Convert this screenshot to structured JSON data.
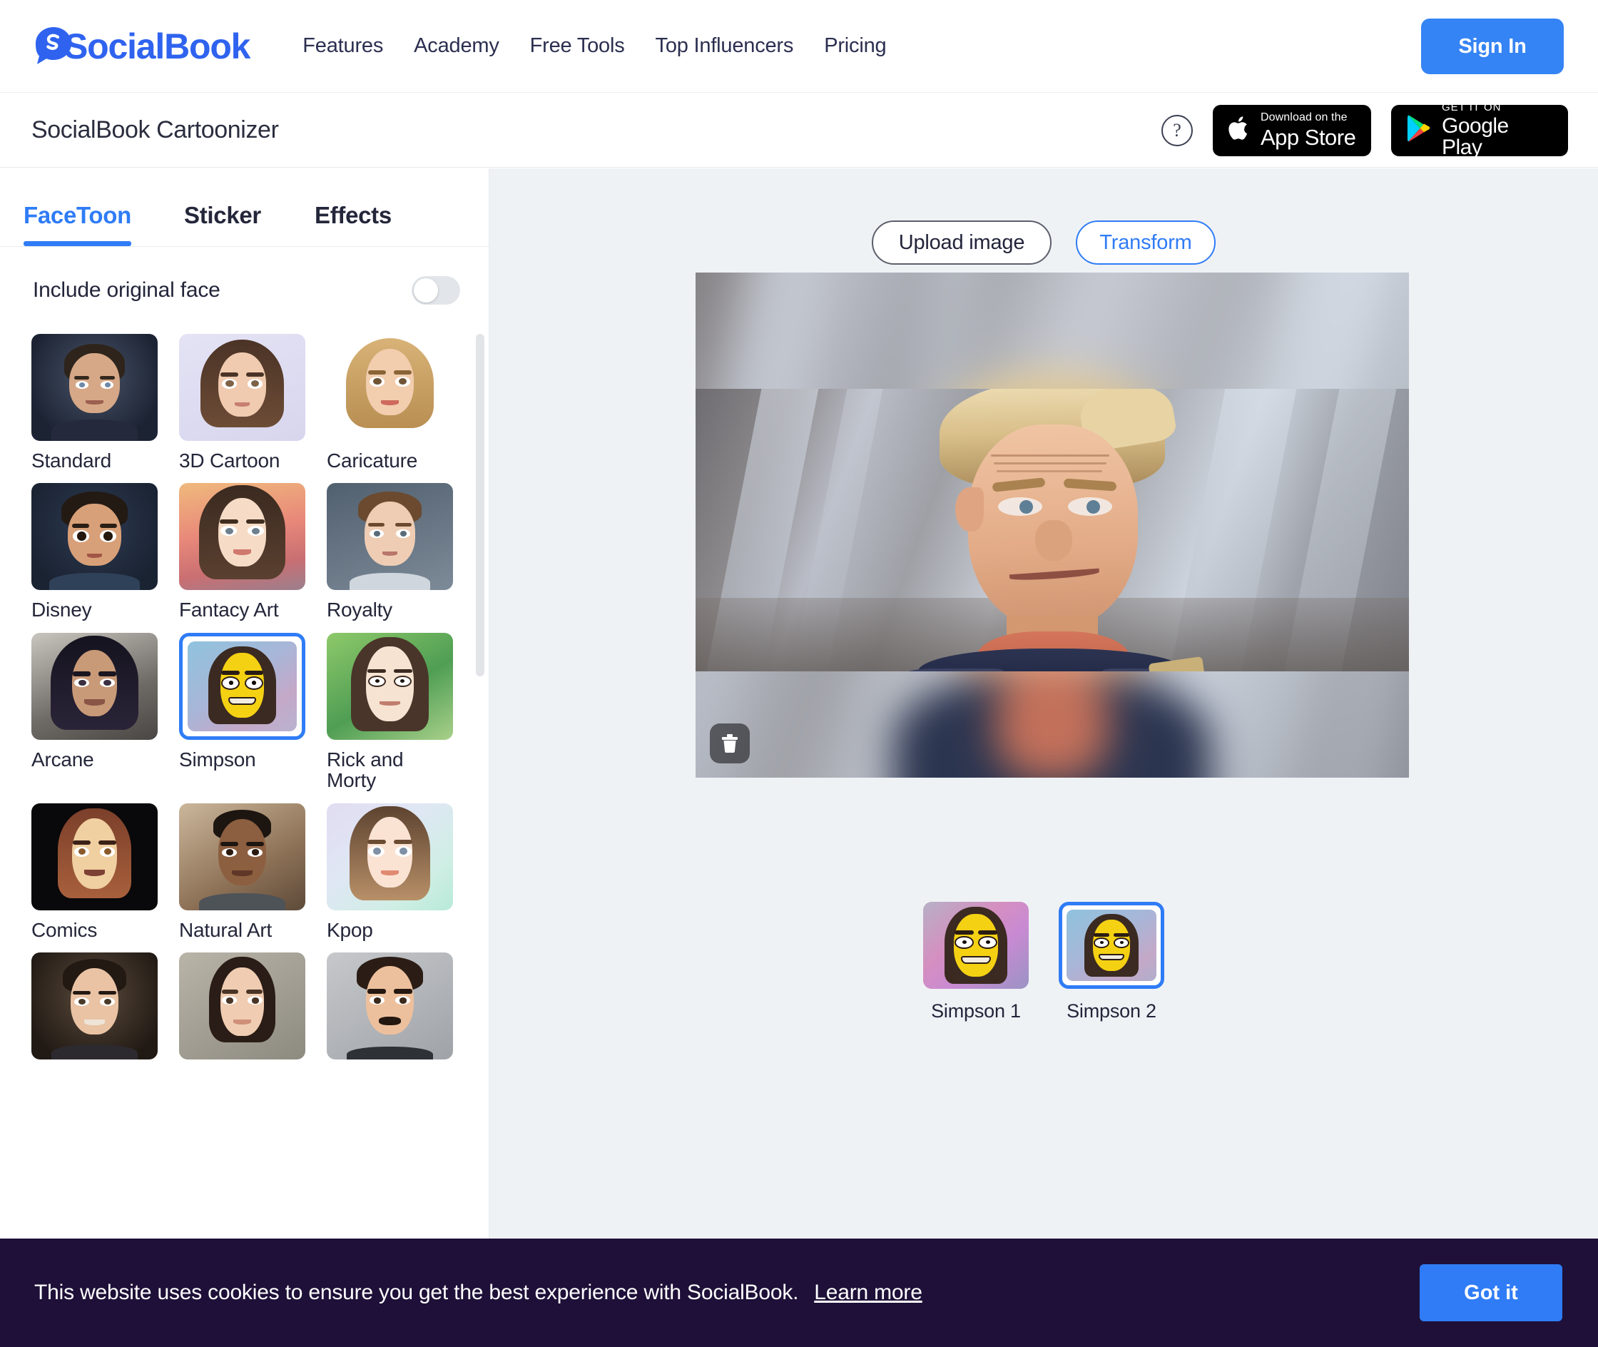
{
  "brand": {
    "name": "SocialBook",
    "logo_icon": "socialbook-speech-bubble-logo",
    "accent_blue": "#2f63ef",
    "button_blue": "#3584f5"
  },
  "topnav": {
    "links": [
      {
        "label": "Features"
      },
      {
        "label": "Academy"
      },
      {
        "label": "Free Tools"
      },
      {
        "label": "Top Influencers"
      },
      {
        "label": "Pricing"
      }
    ],
    "signin_label": "Sign In"
  },
  "subheader": {
    "app_title": "SocialBook Cartoonizer",
    "help_icon": "question-mark-circle-icon",
    "help_glyph": "?",
    "badges": [
      {
        "icon": "apple-logo-icon",
        "small": "Download on the",
        "big": "App Store"
      },
      {
        "icon": "google-play-icon",
        "small": "GET IT ON",
        "big": "Google Play"
      }
    ]
  },
  "sidebar": {
    "tabs": [
      {
        "label": "FaceToon",
        "active": true
      },
      {
        "label": "Sticker",
        "active": false
      },
      {
        "label": "Effects",
        "active": false
      }
    ],
    "toggle": {
      "label": "Include original face",
      "state": "off"
    },
    "styles": [
      {
        "label": "Standard",
        "selected": false
      },
      {
        "label": "3D Cartoon",
        "selected": false
      },
      {
        "label": "Caricature",
        "selected": false
      },
      {
        "label": "Disney",
        "selected": false
      },
      {
        "label": "Fantacy Art",
        "selected": false
      },
      {
        "label": "Royalty",
        "selected": false
      },
      {
        "label": "Arcane",
        "selected": false
      },
      {
        "label": "Simpson",
        "selected": true
      },
      {
        "label": "Rick and Morty",
        "selected": false
      },
      {
        "label": "Comics",
        "selected": false
      },
      {
        "label": "Natural Art",
        "selected": false
      },
      {
        "label": "Kpop",
        "selected": false
      },
      {
        "label": "",
        "selected": false
      },
      {
        "label": "",
        "selected": false
      },
      {
        "label": "",
        "selected": false
      }
    ]
  },
  "canvas": {
    "upload_label": "Upload image",
    "transform_label": "Transform",
    "delete_icon": "trash-icon",
    "image_description": "blond man in dark blue and red superhero suit smirking"
  },
  "results": [
    {
      "label": "Simpson 1",
      "selected": false
    },
    {
      "label": "Simpson 2",
      "selected": true
    }
  ],
  "cookiebar": {
    "message": "This website uses cookies to ensure you get the best experience with SocialBook.",
    "link_label": "Learn more",
    "accept_label": "Got it",
    "background": "#1e1038",
    "accept_color": "#2f7cf6"
  }
}
